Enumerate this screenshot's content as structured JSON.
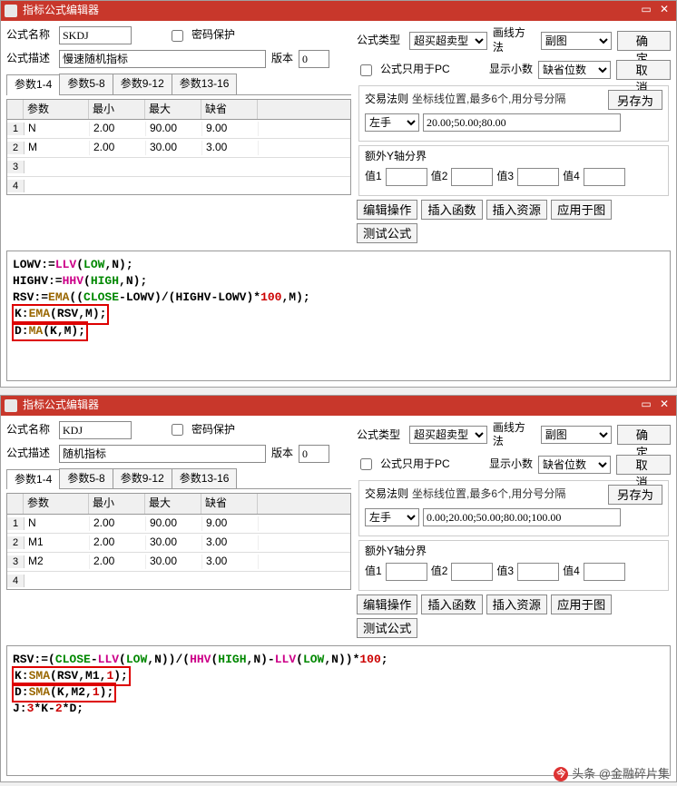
{
  "windows": [
    {
      "title": "指标公式编辑器",
      "formulaNameLabel": "公式名称",
      "formulaName": "SKDJ",
      "pwdProtect": "密码保护",
      "formulaTypeLabel": "公式类型",
      "formulaType": "超买超卖型",
      "drawMethodLabel": "画线方法",
      "drawMethod": "副图",
      "descLabel": "公式描述",
      "desc": "慢速随机指标",
      "versionLabel": "版本",
      "version": "0",
      "pcOnly": "公式只用于PC",
      "decimalsLabel": "显示小数",
      "decimals": "缺省位数",
      "tabs": [
        "参数1-4",
        "参数5-8",
        "参数9-12",
        "参数13-16"
      ],
      "gridHeaders": [
        "参数",
        "最小",
        "最大",
        "缺省"
      ],
      "params": [
        [
          "N",
          "2.00",
          "90.00",
          "9.00"
        ],
        [
          "M",
          "2.00",
          "30.00",
          "3.00"
        ]
      ],
      "ruleLabel": "交易法则",
      "ruleHint": "坐标线位置,最多6个,用分号分隔",
      "ruleHand": "左手",
      "ruleValue": "20.00;50.00;80.00",
      "extraYLabel": "额外Y轴分界",
      "extraY": [
        "值1",
        "值2",
        "值3",
        "值4"
      ],
      "btns": {
        "ok": "确  定",
        "cancel": "取  消",
        "saveAs": "另存为",
        "edit": "编辑操作",
        "insFn": "插入函数",
        "insRes": "插入资源",
        "apply": "应用于图",
        "test": "测试公式"
      },
      "code": [
        {
          "t": "LOWV:=",
          "c": ""
        },
        {
          "t": "LLV",
          "c": "kw-pink"
        },
        {
          "t": "(",
          "c": ""
        },
        {
          "t": "LOW",
          "c": "kw-green"
        },
        {
          "t": ",N);\n",
          "c": ""
        },
        {
          "t": "HIGHV:=",
          "c": ""
        },
        {
          "t": "HHV",
          "c": "kw-pink"
        },
        {
          "t": "(",
          "c": ""
        },
        {
          "t": "HIGH",
          "c": "kw-green"
        },
        {
          "t": ",N);\n",
          "c": ""
        },
        {
          "t": "RSV:=",
          "c": ""
        },
        {
          "t": "EMA",
          "c": "kw-brown"
        },
        {
          "t": "((",
          "c": ""
        },
        {
          "t": "CLOSE",
          "c": "kw-green"
        },
        {
          "t": "-LOWV)/(HIGHV-LOWV)*",
          "c": ""
        },
        {
          "t": "100",
          "c": "kw-red"
        },
        {
          "t": ",M);\n",
          "c": ""
        },
        {
          "t": "K:",
          "c": "",
          "box": 1
        },
        {
          "t": "EMA",
          "c": "kw-brown",
          "box": 1
        },
        {
          "t": "(RSV,M);",
          "c": "",
          "box": 1
        },
        {
          "t": "\n",
          "c": ""
        },
        {
          "t": "D:",
          "c": "",
          "box": 1
        },
        {
          "t": "MA",
          "c": "kw-brown",
          "box": 1
        },
        {
          "t": "(K,M);",
          "c": "",
          "box": 1
        }
      ]
    },
    {
      "title": "指标公式编辑器",
      "formulaNameLabel": "公式名称",
      "formulaName": "KDJ",
      "pwdProtect": "密码保护",
      "formulaTypeLabel": "公式类型",
      "formulaType": "超买超卖型",
      "drawMethodLabel": "画线方法",
      "drawMethod": "副图",
      "descLabel": "公式描述",
      "desc": "随机指标",
      "versionLabel": "版本",
      "version": "0",
      "pcOnly": "公式只用于PC",
      "decimalsLabel": "显示小数",
      "decimals": "缺省位数",
      "tabs": [
        "参数1-4",
        "参数5-8",
        "参数9-12",
        "参数13-16"
      ],
      "gridHeaders": [
        "参数",
        "最小",
        "最大",
        "缺省"
      ],
      "params": [
        [
          "N",
          "2.00",
          "90.00",
          "9.00"
        ],
        [
          "M1",
          "2.00",
          "30.00",
          "3.00"
        ],
        [
          "M2",
          "2.00",
          "30.00",
          "3.00"
        ]
      ],
      "ruleLabel": "交易法则",
      "ruleHint": "坐标线位置,最多6个,用分号分隔",
      "ruleHand": "左手",
      "ruleValue": "0.00;20.00;50.00;80.00;100.00",
      "extraYLabel": "额外Y轴分界",
      "extraY": [
        "值1",
        "值2",
        "值3",
        "值4"
      ],
      "btns": {
        "ok": "确  定",
        "cancel": "取  消",
        "saveAs": "另存为",
        "edit": "编辑操作",
        "insFn": "插入函数",
        "insRes": "插入资源",
        "apply": "应用于图",
        "test": "测试公式"
      },
      "code": [
        {
          "t": "RSV:=(",
          "c": ""
        },
        {
          "t": "CLOSE",
          "c": "kw-green"
        },
        {
          "t": "-",
          "c": ""
        },
        {
          "t": "LLV",
          "c": "kw-pink"
        },
        {
          "t": "(",
          "c": ""
        },
        {
          "t": "LOW",
          "c": "kw-green"
        },
        {
          "t": ",N))/(",
          "c": ""
        },
        {
          "t": "HHV",
          "c": "kw-pink"
        },
        {
          "t": "(",
          "c": ""
        },
        {
          "t": "HIGH",
          "c": "kw-green"
        },
        {
          "t": ",N)-",
          "c": ""
        },
        {
          "t": "LLV",
          "c": "kw-pink"
        },
        {
          "t": "(",
          "c": ""
        },
        {
          "t": "LOW",
          "c": "kw-green"
        },
        {
          "t": ",N))*",
          "c": ""
        },
        {
          "t": "100",
          "c": "kw-red"
        },
        {
          "t": ";\n",
          "c": ""
        },
        {
          "t": "K:",
          "c": "",
          "box": 1
        },
        {
          "t": "SMA",
          "c": "kw-brown",
          "box": 1
        },
        {
          "t": "(RSV,M1,",
          "c": "",
          "box": 1
        },
        {
          "t": "1",
          "c": "kw-red",
          "box": 1
        },
        {
          "t": ");",
          "c": "",
          "box": 1
        },
        {
          "t": "\n",
          "c": ""
        },
        {
          "t": "D:",
          "c": "",
          "box": 1
        },
        {
          "t": "SMA",
          "c": "kw-brown",
          "box": 1
        },
        {
          "t": "(K,M2,",
          "c": "",
          "box": 1
        },
        {
          "t": "1",
          "c": "kw-red",
          "box": 1
        },
        {
          "t": ");",
          "c": "",
          "box": 1
        },
        {
          "t": "\n",
          "c": ""
        },
        {
          "t": "J:",
          "c": ""
        },
        {
          "t": "3",
          "c": "kw-red"
        },
        {
          "t": "*K-",
          "c": ""
        },
        {
          "t": "2",
          "c": "kw-red"
        },
        {
          "t": "*D;",
          "c": ""
        }
      ]
    }
  ],
  "watermark": "头条 @金融碎片集"
}
